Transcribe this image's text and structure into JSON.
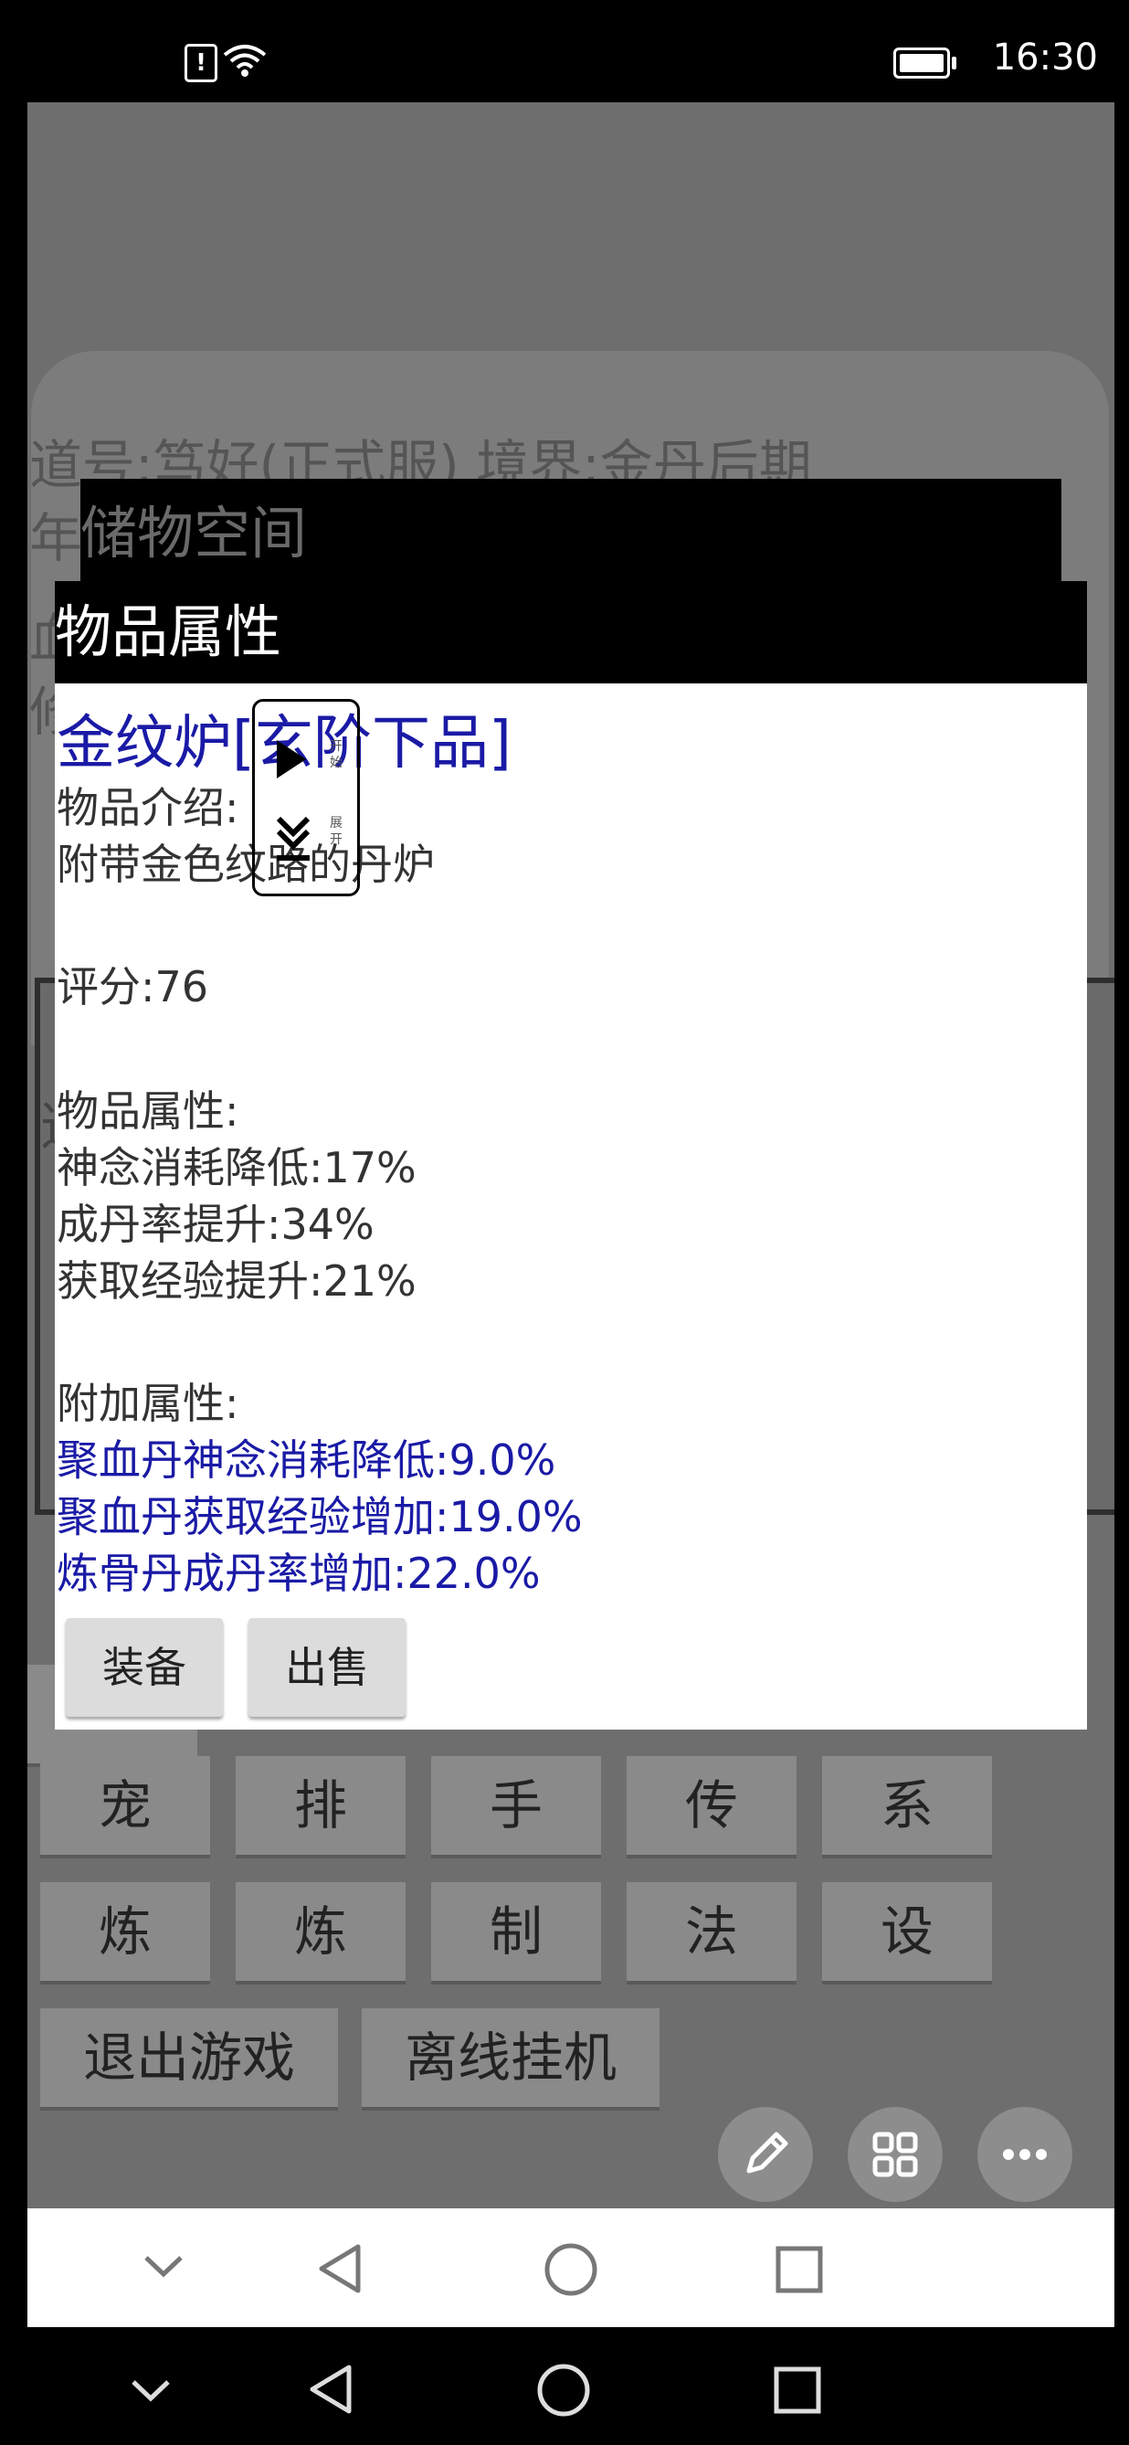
{
  "status_bar": {
    "time": "16:30",
    "icons": [
      "sim-alert-icon",
      "wifi-icon",
      "battery-icon"
    ]
  },
  "background": {
    "info_line1": "道号:笃好(正式服)  境界:金丹后期",
    "info_line2_char": "年",
    "info_line3_char": "血",
    "info_line4_char": "修",
    "panel_char": "道",
    "grid_row1": [
      "宠",
      "排",
      "手",
      "传",
      "系"
    ],
    "grid_row2": [
      "炼",
      "炼",
      "制",
      "法",
      "设"
    ],
    "exit_game": "退出游戏",
    "offline_idle": "离线挂机"
  },
  "storage_bar": {
    "title": "储物空间"
  },
  "dialog": {
    "title": "物品属性",
    "item_name": "金纹炉[玄阶下品]",
    "intro_label": "物品介绍:",
    "intro_text": "附带金色纹路的丹炉",
    "score": "评分:76",
    "attributes_label": "物品属性:",
    "attributes": [
      "神念消耗降低:17%",
      "成丹率提升:34%",
      "获取经验提升:21%"
    ],
    "extra_label": "附加属性:",
    "extra_attributes": [
      "聚血丹神念消耗降低:9.0%",
      "聚血丹获取经验增加:19.0%",
      "炼骨丹成丹率增加:22.0%"
    ],
    "equip_button": "装备",
    "sell_button": "出售"
  },
  "floating_control": {
    "start_label": "开始",
    "expand_label": "展开"
  },
  "colors": {
    "item_name": "#1a1aa6",
    "extra_attributes": "#1a1aa6"
  }
}
